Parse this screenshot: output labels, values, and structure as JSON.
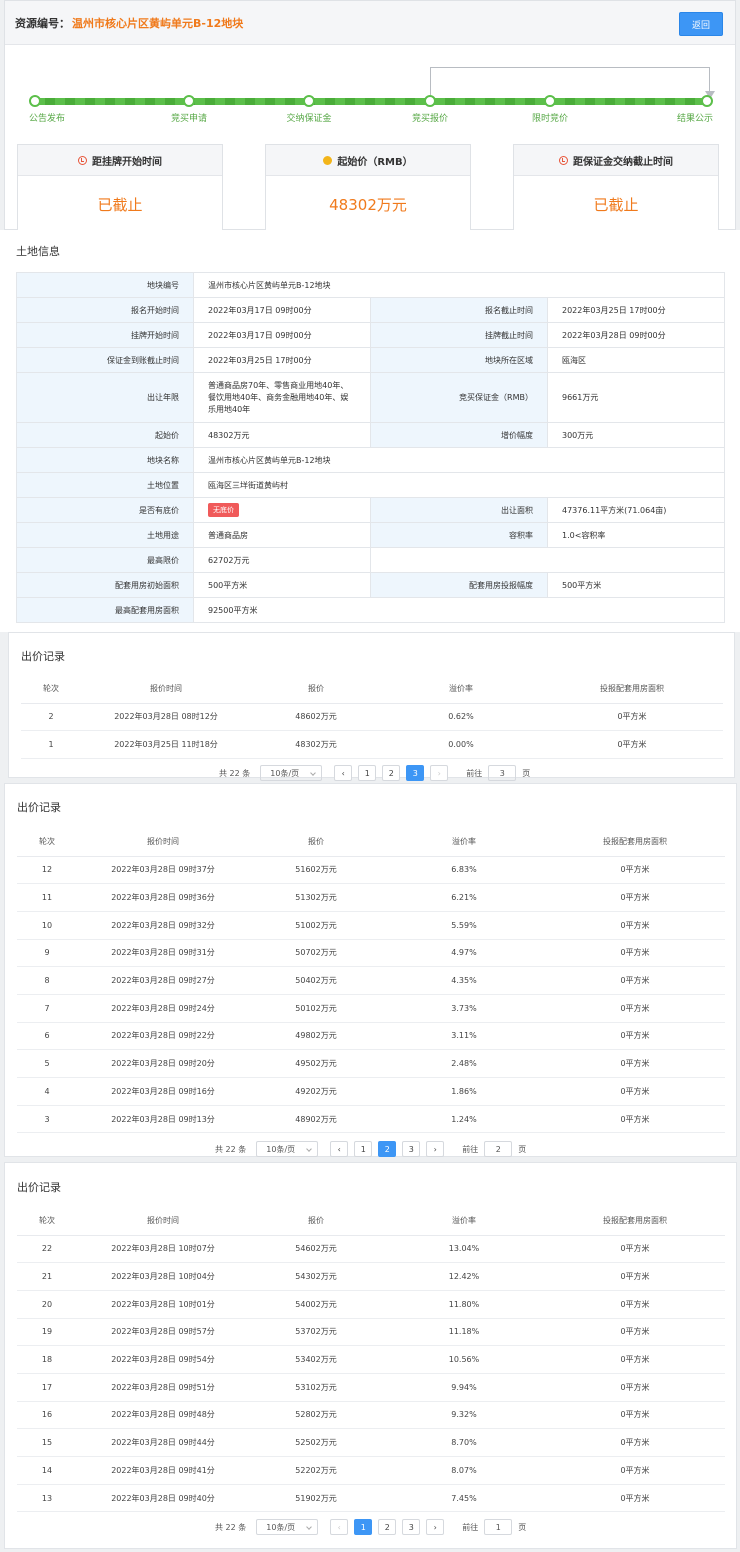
{
  "header": {
    "resource_label": "资源编号：",
    "resource_value": "温州市核心片区黄屿单元B-12地块",
    "back_label": "返回"
  },
  "steps": [
    "公告发布",
    "竞买申请",
    "交纳保证金",
    "竞买报价",
    "限时竞价",
    "结果公示"
  ],
  "cards": [
    {
      "title": "距挂牌开始时间",
      "value": "已截止"
    },
    {
      "title": "起始价（RMB）",
      "value": "48302万元"
    },
    {
      "title": "距保证金交纳截止时间",
      "value": "已截止"
    }
  ],
  "land": {
    "title": "土地信息",
    "rows": [
      {
        "k1": "地块编号",
        "v1": "温州市核心片区黄屿单元B-12地块"
      },
      {
        "k1": "报名开始时间",
        "v1": "2022年03月17日 09时00分",
        "k2": "报名截止时间",
        "v2": "2022年03月25日 17时00分"
      },
      {
        "k1": "挂牌开始时间",
        "v1": "2022年03月17日 09时00分",
        "k2": "挂牌截止时间",
        "v2": "2022年03月28日 09时00分"
      },
      {
        "k1": "保证金到账截止时间",
        "v1": "2022年03月25日 17时00分",
        "k2": "地块所在区域",
        "v2": "瓯海区"
      },
      {
        "k1": "出让年限",
        "v1": "普通商品房70年、零售商业用地40年、餐饮用地40年、商务金融用地40年、娱乐用地40年",
        "k2": "竞买保证金（RMB）",
        "v2": "9661万元"
      },
      {
        "k1": "起始价",
        "v1": "48302万元",
        "k2": "增价幅度",
        "v2": "300万元"
      },
      {
        "k1": "地块名称",
        "v1": "温州市核心片区黄屿单元B-12地块"
      },
      {
        "k1": "土地位置",
        "v1": "瓯海区三垟街道黄屿村"
      },
      {
        "k1": "是否有底价",
        "v1": "无底价",
        "k2": "出让面积",
        "v2": "47376.11平方米(71.064亩)"
      },
      {
        "k1": "土地用途",
        "v1": "普通商品房",
        "k2": "容积率",
        "v2": "1.0<容积率"
      },
      {
        "k1": "最高限价",
        "v1": "62702万元"
      },
      {
        "k1": "配套用房初始面积",
        "v1": "500平方米",
        "k2": "配套用房投报幅度",
        "v2": "500平方米"
      },
      {
        "k1": "最高配套用房面积",
        "v1": "92500平方米"
      }
    ]
  },
  "bids": {
    "title": "出价记录",
    "columns": [
      "轮次",
      "报价时间",
      "报价",
      "溢价率",
      "投报配套用房面积"
    ],
    "total": "共 22 条",
    "page_size": "10条/页",
    "goto_label": "前往",
    "page_suffix": "页",
    "page3": {
      "rows": [
        [
          "2",
          "2022年03月28日 08时12分",
          "48602万元",
          "0.62%",
          "0平方米"
        ],
        [
          "1",
          "2022年03月25日 11时18分",
          "48302万元",
          "0.00%",
          "0平方米"
        ]
      ],
      "goto_value": "3"
    },
    "page2": {
      "rows": [
        [
          "12",
          "2022年03月28日 09时37分",
          "51602万元",
          "6.83%",
          "0平方米"
        ],
        [
          "11",
          "2022年03月28日 09时36分",
          "51302万元",
          "6.21%",
          "0平方米"
        ],
        [
          "10",
          "2022年03月28日 09时32分",
          "51002万元",
          "5.59%",
          "0平方米"
        ],
        [
          "9",
          "2022年03月28日 09时31分",
          "50702万元",
          "4.97%",
          "0平方米"
        ],
        [
          "8",
          "2022年03月28日 09时27分",
          "50402万元",
          "4.35%",
          "0平方米"
        ],
        [
          "7",
          "2022年03月28日 09时24分",
          "50102万元",
          "3.73%",
          "0平方米"
        ],
        [
          "6",
          "2022年03月28日 09时22分",
          "49802万元",
          "3.11%",
          "0平方米"
        ],
        [
          "5",
          "2022年03月28日 09时20分",
          "49502万元",
          "2.48%",
          "0平方米"
        ],
        [
          "4",
          "2022年03月28日 09时16分",
          "49202万元",
          "1.86%",
          "0平方米"
        ],
        [
          "3",
          "2022年03月28日 09时13分",
          "48902万元",
          "1.24%",
          "0平方米"
        ]
      ],
      "goto_value": "2"
    },
    "page1": {
      "rows": [
        [
          "22",
          "2022年03月28日 10时07分",
          "54602万元",
          "13.04%",
          "0平方米"
        ],
        [
          "21",
          "2022年03月28日 10时04分",
          "54302万元",
          "12.42%",
          "0平方米"
        ],
        [
          "20",
          "2022年03月28日 10时01分",
          "54002万元",
          "11.80%",
          "0平方米"
        ],
        [
          "19",
          "2022年03月28日 09时57分",
          "53702万元",
          "11.18%",
          "0平方米"
        ],
        [
          "18",
          "2022年03月28日 09时54分",
          "53402万元",
          "10.56%",
          "0平方米"
        ],
        [
          "17",
          "2022年03月28日 09时51分",
          "53102万元",
          "9.94%",
          "0平方米"
        ],
        [
          "16",
          "2022年03月28日 09时48分",
          "52802万元",
          "9.32%",
          "0平方米"
        ],
        [
          "15",
          "2022年03月28日 09时44分",
          "52502万元",
          "8.70%",
          "0平方米"
        ],
        [
          "14",
          "2022年03月28日 09时41分",
          "52202万元",
          "8.07%",
          "0平方米"
        ],
        [
          "13",
          "2022年03月28日 09时40分",
          "51902万元",
          "7.45%",
          "0平方米"
        ]
      ],
      "goto_value": "1"
    },
    "pages": [
      "1",
      "2",
      "3"
    ],
    "prev_icon": "chevron-left-icon",
    "next_icon": "chevron-right-icon"
  },
  "colors": {
    "accent": "#3d96f5",
    "orange": "#f07a1c",
    "progress_green": "#5cbf4a",
    "label_bg": "#eef6fd",
    "badge_red": "#f05a5a"
  }
}
